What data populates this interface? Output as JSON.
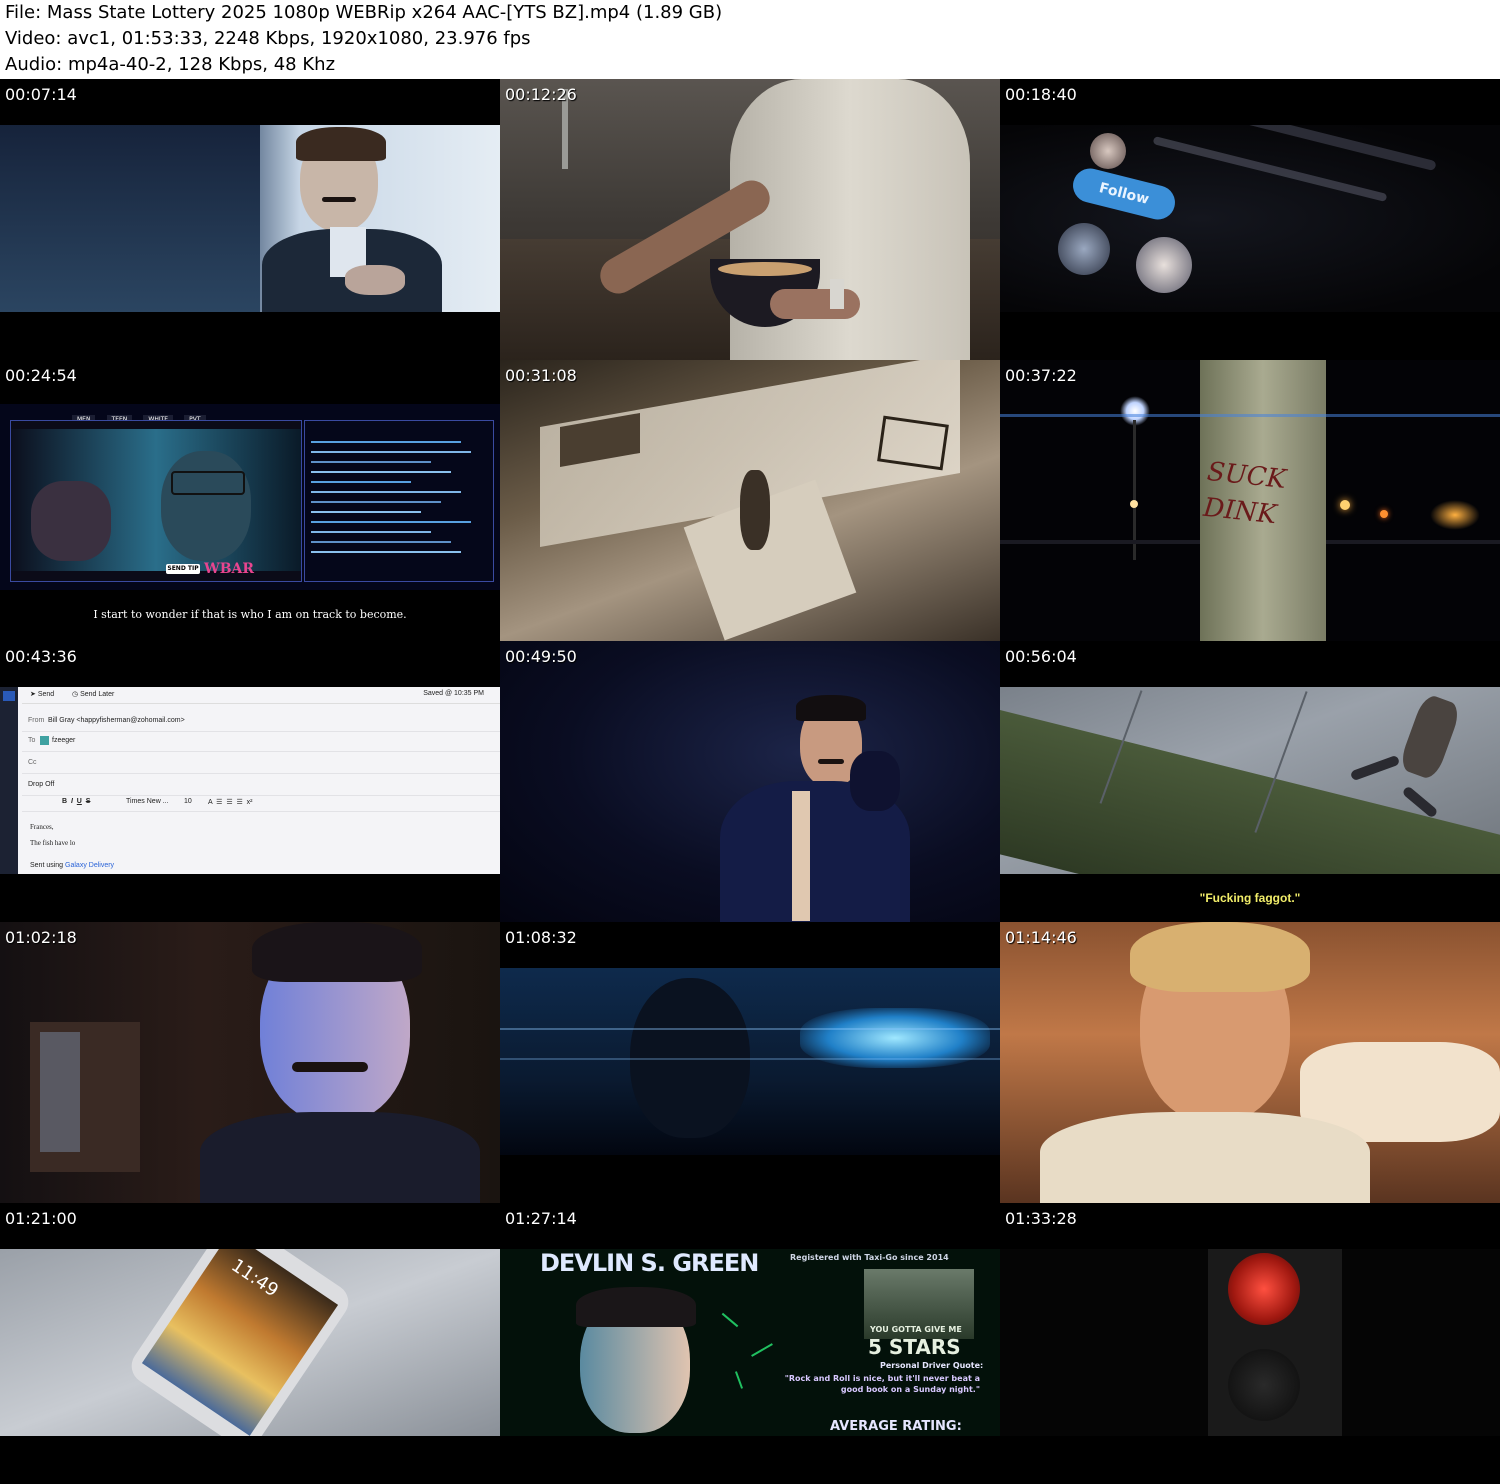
{
  "header": {
    "file_line": "File: Mass State Lottery 2025 1080p WEBRip x264 AAC-[YTS BZ].mp4 (1.89 GB)",
    "video_line": "Video: avc1, 01:53:33, 2248 Kbps, 1920x1080, 23.976 fps",
    "audio_line": "Audio: mp4a-40-2, 128 Kbps, 48 Khz"
  },
  "thumbnails": [
    {
      "timestamp": "00:07:14"
    },
    {
      "timestamp": "00:12:26"
    },
    {
      "timestamp": "00:18:40",
      "follow_button": "Follow"
    },
    {
      "timestamp": "00:24:54",
      "subtitle": "I start to wonder if that is who I am on track to become.",
      "chat_tabs": [
        "MEN",
        "TEEN",
        "WHITE",
        "PVT"
      ],
      "brand": "WBAR",
      "tip_button": "SEND TIP"
    },
    {
      "timestamp": "00:31:08"
    },
    {
      "timestamp": "00:37:22",
      "graffiti": "SUCK DINK"
    },
    {
      "timestamp": "00:43:36",
      "email": {
        "send": "Send",
        "send_later": "Send Later",
        "saved": "Saved @ 10:35 PM",
        "from_label": "From",
        "from_value": "Bill Gray <happyfisherman@zohomail.com>",
        "to_label": "To",
        "to_value": "fzeeger",
        "cc_label": "Cc",
        "subject": "Drop Off",
        "font": "Times New ...",
        "size": "10",
        "body1": "Frances,",
        "body2": "The fish have lo",
        "signature_prefix": "Sent using ",
        "signature_link": "Galaxy Delivery"
      }
    },
    {
      "timestamp": "00:49:50"
    },
    {
      "timestamp": "00:56:04",
      "subtitle": "\"Fucking faggot.\""
    },
    {
      "timestamp": "01:02:18"
    },
    {
      "timestamp": "01:08:32"
    },
    {
      "timestamp": "01:14:46"
    },
    {
      "timestamp": "01:21:00",
      "phone_time": "11:49"
    },
    {
      "timestamp": "01:27:14",
      "devlin": {
        "name": "DEVLIN S. GREEN",
        "registered": "Registered with Taxi-Go since 2014",
        "stars_top": "YOU GOTTA GIVE ME",
        "stars": "5 STARS",
        "quote_label": "Personal Driver Quote:",
        "quote": "\"Rock and Roll is nice, but it'll never beat a good book on a Sunday night.\"",
        "rating": "AVERAGE RATING:"
      }
    },
    {
      "timestamp": "01:33:28"
    }
  ],
  "colors": {
    "subtitle_white": "#ffffff",
    "subtitle_yellow": "#f2ee6a",
    "follow_blue": "#3b8fd8",
    "wbar_pink": "#e8458f"
  }
}
